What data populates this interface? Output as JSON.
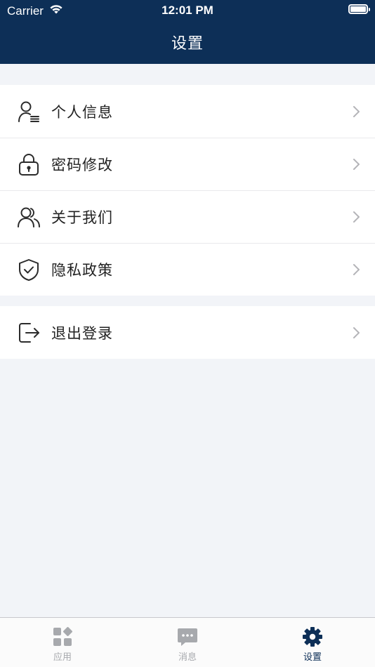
{
  "status_bar": {
    "carrier": "Carrier",
    "time": "12:01 PM",
    "icons": [
      "wifi-icon",
      "battery-icon"
    ]
  },
  "nav": {
    "title": "设置"
  },
  "menu": {
    "group_1": [
      {
        "label": "个人信息",
        "icon": "personal-info-icon"
      },
      {
        "label": "密码修改",
        "icon": "lock-icon"
      },
      {
        "label": "关于我们",
        "icon": "users-icon"
      },
      {
        "label": "隐私政策",
        "icon": "shield-check-icon"
      }
    ],
    "group_2": [
      {
        "label": "退出登录",
        "icon": "logout-icon"
      }
    ]
  },
  "tab_bar": {
    "tabs": [
      {
        "label": "应用",
        "icon": "apps-grid-icon",
        "active": false
      },
      {
        "label": "消息",
        "icon": "message-bubble-icon",
        "active": false
      },
      {
        "label": "设置",
        "icon": "gear-icon",
        "active": true
      }
    ]
  },
  "colors": {
    "header_bg": "#0d2f57",
    "page_bg": "#f2f4f8",
    "tab_active": "#0d2f57",
    "tab_inactive": "#a7a9ad",
    "chevron": "#b4b4b8"
  }
}
